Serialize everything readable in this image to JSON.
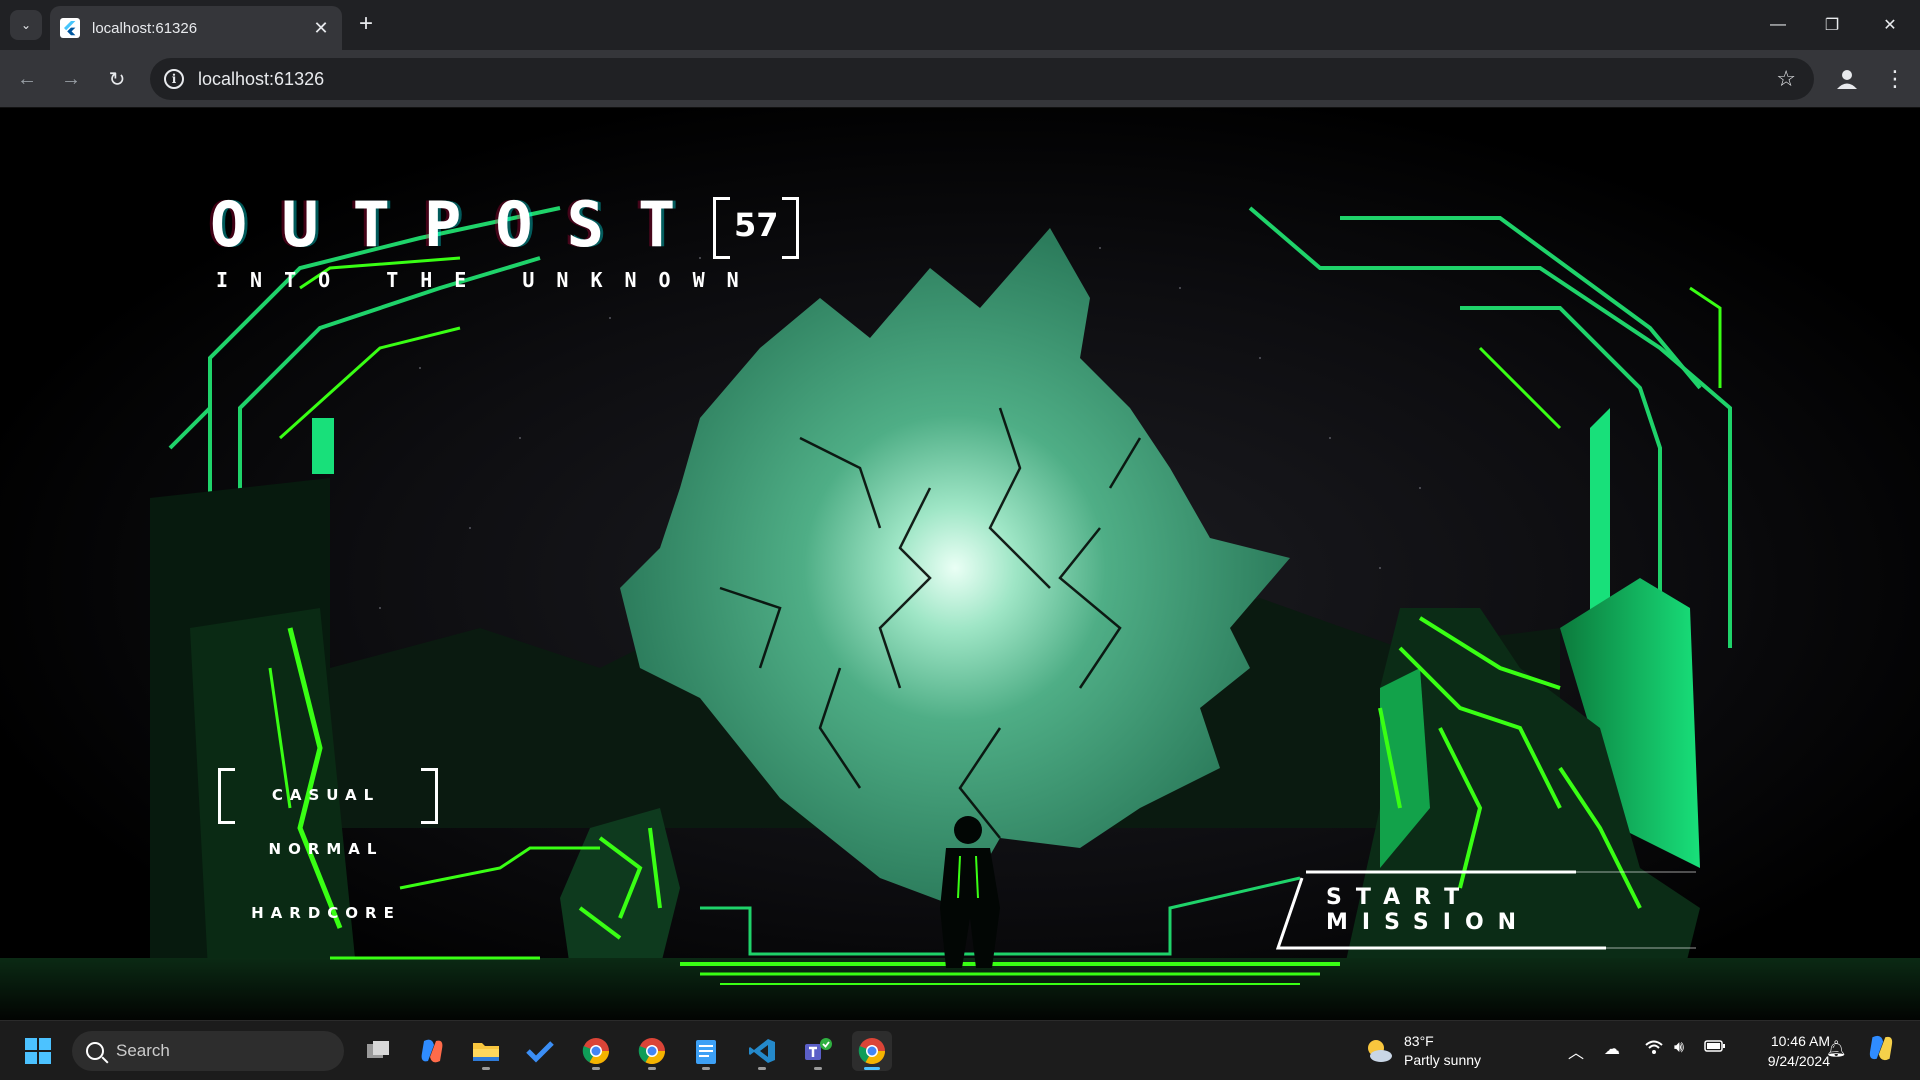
{
  "browser": {
    "tab_title": "localhost:61326",
    "url": "localhost:61326",
    "new_tab_symbol": "+",
    "close_symbol": "✕"
  },
  "game": {
    "title": "OUTPOST",
    "title_badge": "57",
    "subtitle": "INTO THE UNKNOWN",
    "difficulties": [
      "CASUAL",
      "NORMAL",
      "HARDCORE"
    ],
    "selected_difficulty": "CASUAL",
    "start_label": "START MISSION",
    "colors": {
      "accent": "#39ff14",
      "crystal": "#3aa37b",
      "frame": "#0fd46a"
    }
  },
  "taskbar": {
    "search_label": "Search",
    "weather_temp": "83°F",
    "weather_desc": "Partly sunny",
    "time": "10:46 AM",
    "date": "9/24/2024",
    "apps": [
      "task-view",
      "copilot",
      "file-explorer",
      "todo",
      "chrome-profile-1",
      "chrome-profile-2",
      "notepad",
      "vscode",
      "teams",
      "chrome"
    ]
  }
}
